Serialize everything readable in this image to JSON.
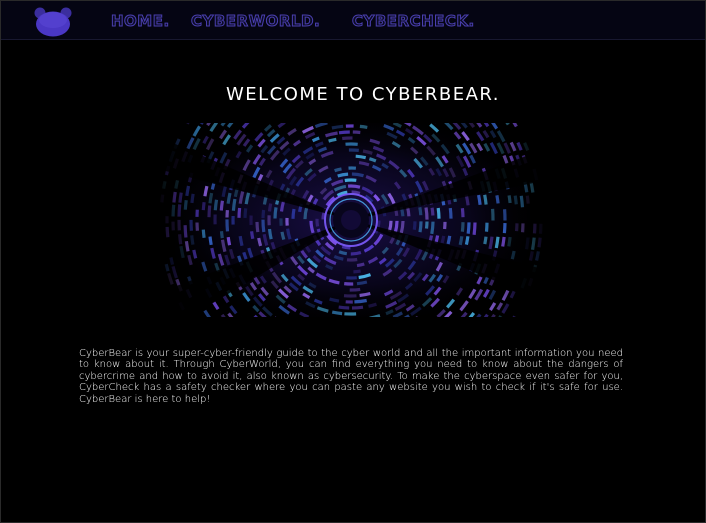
{
  "nav": {
    "logo_icon": "bear-head-icon",
    "items": [
      {
        "label": "HOME."
      },
      {
        "label": "CYBERWORLD."
      },
      {
        "label": "CYBERCHECK."
      }
    ]
  },
  "main": {
    "title": "WELCOME TO CYBERBEAR.",
    "hero_icon": "cyber-tunnel-image",
    "intro": "CyberBear is your super-cyber-friendly guide to the cyber world and all the important information you need to know about it. Through CyberWorld, you can find everything you need to know about the dangers of cybercrime and how to avoid it, also known as cybersecurity. To make the cyberspace even safer for you, CyberCheck has a safety checker where you can paste any website you wish to check if it's safe for use. CyberBear is here to help!"
  },
  "colors": {
    "background": "#000000",
    "navbar": "#050513",
    "accent": "#4a3fb0",
    "text": "#ffffff"
  }
}
